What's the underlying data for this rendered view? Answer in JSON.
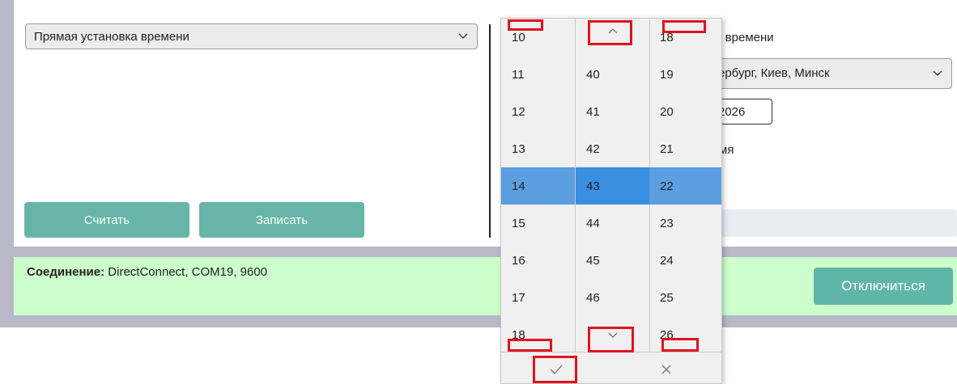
{
  "left_panel": {
    "mode_select": {
      "value": "Прямая установка времени"
    },
    "read_button": "Считать",
    "write_button": "Записать"
  },
  "right_panel": {
    "label_fragment": "у времени",
    "timezone_fragment": "ербург, Киев, Минск",
    "date_fragment": "2026",
    "time_fragment": "мя"
  },
  "connection": {
    "label": "Соединение:",
    "value": "DirectConnect, COM19, 9600",
    "disconnect_button": "Отключиться"
  },
  "time_picker": {
    "hours": [
      "10",
      "11",
      "12",
      "13",
      "14",
      "15",
      "16",
      "17",
      "18"
    ],
    "minutes": [
      "",
      "40",
      "41",
      "42",
      "43",
      "44",
      "45",
      "46",
      ""
    ],
    "seconds": [
      "18",
      "19",
      "20",
      "21",
      "22",
      "23",
      "24",
      "25",
      "26"
    ],
    "selected_index": 4,
    "accent": "#5b9fe0"
  },
  "icons": {
    "scroll_up": "chevron-up-icon",
    "scroll_down": "chevron-down-icon",
    "confirm": "check-icon",
    "cancel": "close-icon",
    "dropdown": "chevron-down-icon"
  }
}
